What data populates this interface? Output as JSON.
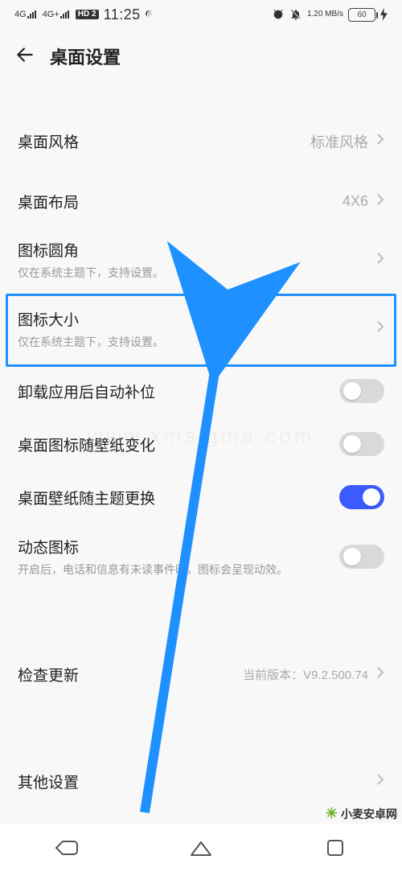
{
  "statusbar": {
    "signal1": "4G",
    "signal2": "4G+",
    "hd": "HD 2",
    "time": "11:25",
    "speed": "1.20 MB/s",
    "battery_label": "60"
  },
  "header": {
    "title": "桌面设置"
  },
  "rows": {
    "style": {
      "title": "桌面风格",
      "value": "标准风格"
    },
    "layout": {
      "title": "桌面布局",
      "value": "4X6"
    },
    "iconCorner": {
      "title": "图标圆角",
      "sub": "仅在系统主题下，支持设置。"
    },
    "iconSize": {
      "title": "图标大小",
      "sub": "仅在系统主题下，支持设置。"
    },
    "autoFill": {
      "title": "卸载应用后自动补位"
    },
    "iconWallpaper": {
      "title": "桌面图标随壁纸变化"
    },
    "wallpaperTheme": {
      "title": "桌面壁纸随主题更换"
    },
    "dynamicIcon": {
      "title": "动态图标",
      "sub": "开启后，电话和信息有未读事件时，图标会呈现动效。"
    },
    "checkUpdate": {
      "title": "检查更新",
      "value": "当前版本：V9.2.500.74"
    },
    "other": {
      "title": "其他设置"
    }
  },
  "toggles": {
    "autoFill": false,
    "iconWallpaper": false,
    "wallpaperTheme": true,
    "dynamicIcon": false
  },
  "watermarks": {
    "corner": "小麦安卓网",
    "center": "www.xmsigma.com"
  }
}
